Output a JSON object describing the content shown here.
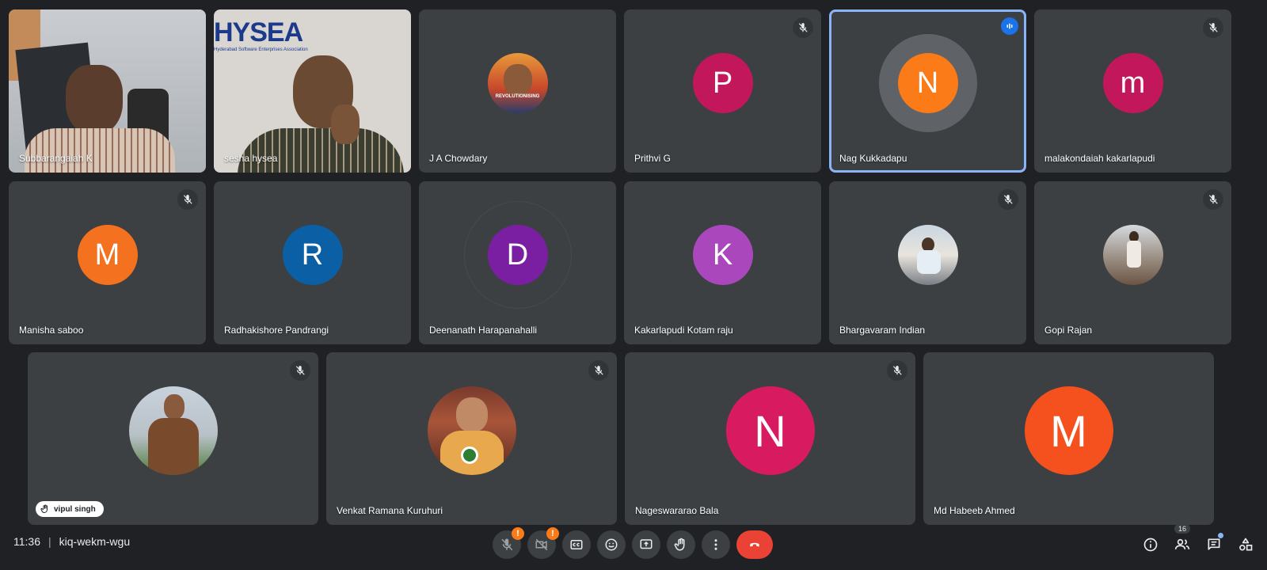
{
  "meeting": {
    "time": "11:36",
    "separator": "|",
    "code": "kiq-wekm-wgu"
  },
  "colors": {
    "background": "#202124",
    "tile": "#3c4043",
    "speaking_outline": "#8ab4f8",
    "end_call": "#ea4335",
    "warning": "#fa7b17"
  },
  "participants": [
    {
      "name": "Subbarangaiah K",
      "type": "video",
      "muted": false
    },
    {
      "name": "sesha hysea",
      "type": "video",
      "muted": false,
      "background_text": "HYSEA",
      "background_subtext": "Hyderabad Software Enterprises Association"
    },
    {
      "name": "J A Chowdary",
      "type": "photo",
      "muted": false,
      "photo_text": "REVOLUTIONISING"
    },
    {
      "name": "Prithvi G",
      "type": "initial",
      "initial": "P",
      "color": "#c2185b",
      "muted": true
    },
    {
      "name": "Nag Kukkadapu",
      "type": "initial",
      "initial": "N",
      "color": "#fa7b17",
      "muted": false,
      "speaking": true
    },
    {
      "name": "malakondaiah kakarlapudi",
      "type": "initial",
      "initial": "m",
      "color": "#c2185b",
      "muted": true
    },
    {
      "name": "Manisha saboo",
      "type": "initial",
      "initial": "M",
      "color": "#f4711f",
      "muted": true
    },
    {
      "name": "Radhakishore Pandrangi",
      "type": "initial",
      "initial": "R",
      "color": "#0b5fa5",
      "muted": false
    },
    {
      "name": "Deenanath Harapanahalli",
      "type": "initial",
      "initial": "D",
      "color": "#7b1fa2",
      "muted": false
    },
    {
      "name": "Kakarlapudi Kotam raju",
      "type": "initial",
      "initial": "K",
      "color": "#ab47bc",
      "muted": false
    },
    {
      "name": "Bhargavaram Indian",
      "type": "photo",
      "muted": true
    },
    {
      "name": "Gopi Rajan",
      "type": "photo",
      "muted": true
    },
    {
      "name": "vipul singh",
      "type": "photo",
      "muted": true,
      "hand_raised": true
    },
    {
      "name": "Venkat Ramana Kuruhuri",
      "type": "photo",
      "muted": true
    },
    {
      "name": "Nageswararao Bala",
      "type": "initial",
      "initial": "N",
      "color": "#d81b60",
      "muted": true
    },
    {
      "name": "Md Habeeb Ahmed",
      "type": "initial",
      "initial": "M",
      "color": "#f4511e",
      "muted": false
    }
  ],
  "controls": {
    "mic": {
      "icon": "mic-off-icon",
      "warning": "!"
    },
    "camera": {
      "icon": "camera-off-icon",
      "warning": "!"
    },
    "captions": {
      "icon": "captions-icon"
    },
    "reactions": {
      "icon": "emoji-icon"
    },
    "present": {
      "icon": "present-screen-icon"
    },
    "raise_hand": {
      "icon": "hand-icon"
    },
    "more": {
      "icon": "more-vert-icon"
    },
    "end_call": {
      "icon": "call-end-icon"
    }
  },
  "right_controls": {
    "info": {
      "icon": "info-icon"
    },
    "people": {
      "icon": "people-icon",
      "count": "16"
    },
    "chat": {
      "icon": "chat-icon"
    },
    "activities": {
      "icon": "activities-icon"
    }
  }
}
